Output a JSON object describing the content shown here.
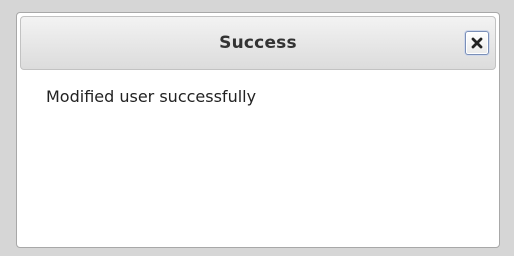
{
  "dialog": {
    "title": "Success",
    "message": "Modified user successfully",
    "close_icon": "close-icon"
  }
}
